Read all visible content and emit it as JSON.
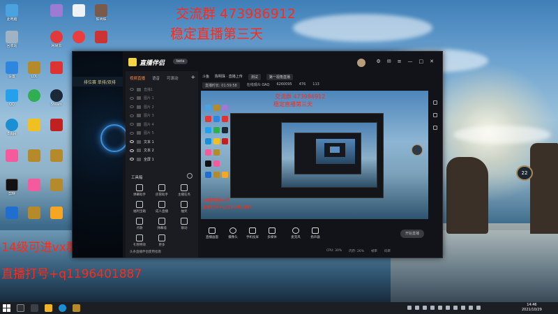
{
  "overlay": {
    "line1": "交流群 473986912",
    "line2": "稳定直播第三天",
    "bottom_line1": "14级可进vx群",
    "bottom_line2": "直播打号+q1196401887"
  },
  "desktop": {
    "left_icons": [
      {
        "label": "此电脑",
        "color": "#4aa3df"
      },
      {
        "label": "回收站",
        "color": "#9fb3c4"
      },
      {
        "label": "网易云",
        "color": "#e23a3a"
      },
      {
        "label": "OBS",
        "color": "#333333"
      },
      {
        "label": "设置",
        "color": "#2e86de"
      },
      {
        "label": "Edge",
        "color": "#1b8fd4"
      },
      {
        "label": "QQ",
        "color": "#24a0ed"
      },
      {
        "label": "WeGame",
        "color": "#d33"
      },
      {
        "label": "剪映",
        "color": "#111"
      },
      {
        "label": "直播伴侣",
        "color": "#111"
      },
      {
        "label": "LOL",
        "color": "#b58a2a"
      },
      {
        "label": "Steam",
        "color": "#1b2838"
      }
    ],
    "account_label": "陈明珠"
  },
  "app": {
    "logo_text": "直播伴侣",
    "beta_label": "beta",
    "game_title": "排位赛 单排/双排",
    "tabs": [
      "视频直播",
      "语音",
      "可滚动"
    ],
    "sources": [
      {
        "label": "直播1",
        "on": false
      },
      {
        "label": "图片 1",
        "on": false
      },
      {
        "label": "图片 2",
        "on": false
      },
      {
        "label": "图片 3",
        "on": false
      },
      {
        "label": "图片 4",
        "on": false
      },
      {
        "label": "图片 5",
        "on": false
      },
      {
        "label": "文本 1",
        "on": true
      },
      {
        "label": "文本 2",
        "on": true
      },
      {
        "label": "全屏 1",
        "on": true
      }
    ],
    "tools_title": "工具箱",
    "tools": [
      "弹幕助手",
      "房管助手",
      "主播任务",
      "福利宝箱",
      "成人直播",
      "抽奖",
      "点歌",
      "弹幕墙",
      "联动",
      "礼物特效",
      "更多"
    ],
    "footer": "头条直播伴侣使用指南",
    "info_row1": [
      "斗鱼",
      "陈明珠 · 直播上传",
      "测试",
      "第一视角直播"
    ],
    "info_row2": [
      "直播时长: 01:59:58",
      "在线观众 OAQ",
      "6260095",
      "476",
      "113"
    ],
    "bottom_buttons": [
      "直播画面",
      "摄像头",
      "手机投屏",
      "多媒体",
      "麦克风",
      "扬声器"
    ],
    "start_label": "开始直播",
    "status": [
      "CPU: 30%",
      "内存: 26%",
      "帧率",
      "码率"
    ]
  },
  "preview": {
    "line1": "交流群 473986912",
    "line2": "稳定直播第三天",
    "bottom_line1": "14级可进vx群",
    "bottom_line2": "直播打号+q1196401887"
  },
  "game": {
    "badge_level": "22"
  },
  "taskbar": {
    "time": "14:46",
    "date": "2021/10/29"
  }
}
